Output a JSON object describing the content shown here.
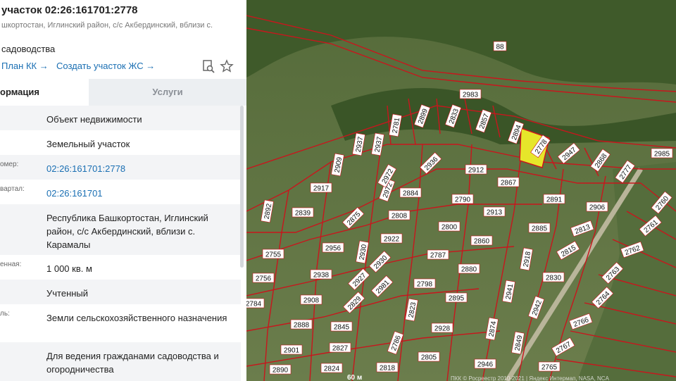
{
  "header": {
    "title": "участок 02:26:161701:2778",
    "address": "шкортостан, Иглинский район, с/с Акбердинский, вблизи с.",
    "kind": "садоводства"
  },
  "actions": {
    "plan_kk": "План КК →",
    "create_zhs": "Создать участок ЖС →",
    "icons": [
      "document-search-icon",
      "star-icon"
    ]
  },
  "tabs": {
    "info": "ормация",
    "services": "Услуги"
  },
  "rows": [
    {
      "label": "",
      "value": "Объект недвижимости"
    },
    {
      "label": "",
      "value": "Земельный участок"
    },
    {
      "label": "омер:",
      "value": "02:26:161701:2778"
    },
    {
      "label": "вартал:",
      "value": "02:26:161701"
    },
    {
      "label": "",
      "value": "Республика Башкортостан, Иглинский район, с/с Акбердинский, вблизи с. Карамалы"
    },
    {
      "label": "енная:",
      "value": "1 000 кв. м"
    },
    {
      "label": "",
      "value": "Учтенный"
    },
    {
      "label": "ль:",
      "value": "Земли сельскохозяйственного назначения"
    },
    {
      "label": "",
      "value": "Для ведения гражданами садоводства и огородничества"
    }
  ],
  "map": {
    "selected_lot": "2778",
    "highlight_color": "#e6e62a",
    "boundary_color": "#c8161d",
    "scale": "60 м",
    "attribution": "ПКК © Росреестр 2010-2021 | Яндекс Интермап, NASA, NCA",
    "lots": [
      "88",
      "2983",
      "2899",
      "2833",
      "2857",
      "2894",
      "2778",
      "2947",
      "2868",
      "2777",
      "2985",
      "2781",
      "2937",
      "2937",
      "2909",
      "2972",
      "2972",
      "2936",
      "2912",
      "2867",
      "2917",
      "2892",
      "2839",
      "2884",
      "2790",
      "2913",
      "2891",
      "2906",
      "2760",
      "2875",
      "2808",
      "2800",
      "2885",
      "2813",
      "2761",
      "2755",
      "2956",
      "2930",
      "2922",
      "2860",
      "2815",
      "2762",
      "2756",
      "2930",
      "2787",
      "2918",
      "2763",
      "2938",
      "2927",
      "2880",
      "2830",
      "2798",
      "2981",
      "2764",
      "2784",
      "2908",
      "2829",
      "2895",
      "2941",
      "2823",
      "2942",
      "2766",
      "2888",
      "2845",
      "2928",
      "2874",
      "2767",
      "2901",
      "2827",
      "2786",
      "2849",
      "2890",
      "2824",
      "2818",
      "2805",
      "2946",
      "2765"
    ]
  }
}
